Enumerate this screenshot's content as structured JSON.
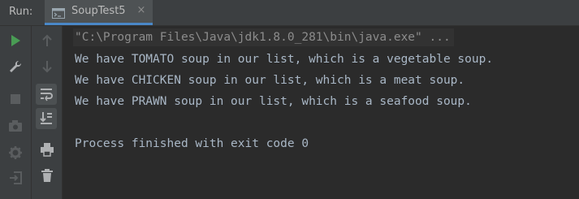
{
  "header": {
    "run_label": "Run:",
    "tab": {
      "title": "SoupTest5",
      "close": "×"
    }
  },
  "toolbar_left": [
    {
      "name": "rerun-icon",
      "color": "#499c54"
    },
    {
      "name": "wrench-icon",
      "color": "#afb1b3"
    },
    {
      "name": "stop-icon",
      "color": "#5a5d5f"
    },
    {
      "name": "camera-icon",
      "color": "#5a5d5f"
    },
    {
      "name": "gear-icon",
      "color": "#5a5d5f"
    },
    {
      "name": "exit-icon",
      "color": "#5a5d5f"
    }
  ],
  "toolbar_right": [
    {
      "name": "up-arrow-icon"
    },
    {
      "name": "down-arrow-icon"
    },
    {
      "name": "soft-wrap-icon",
      "active": true
    },
    {
      "name": "scroll-to-end-icon",
      "active": true
    },
    {
      "name": "print-icon"
    },
    {
      "name": "trash-icon"
    }
  ],
  "console": {
    "command": "\"C:\\Program Files\\Java\\jdk1.8.0_281\\bin\\java.exe\" ...",
    "lines": [
      "We have TOMATO soup in our list, which is a vegetable soup.",
      "We have CHICKEN soup in our list, which is a meat soup.",
      "We have PRAWN soup in our list, which is a seafood soup.",
      "",
      "Process finished with exit code 0"
    ]
  }
}
